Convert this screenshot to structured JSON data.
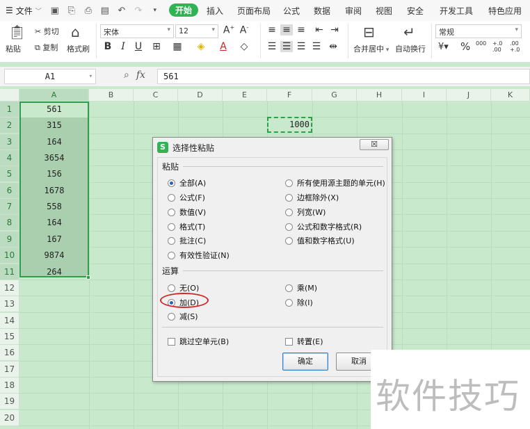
{
  "menubar": {
    "file_label": "文件",
    "tabs": [
      "开始",
      "插入",
      "页面布局",
      "公式",
      "数据",
      "审阅",
      "视图",
      "安全",
      "开发工具",
      "特色应用"
    ],
    "active_tab": "开始"
  },
  "ribbon": {
    "paste_label": "粘贴",
    "cut_label": "剪切",
    "copy_label": "复制",
    "format_painter_label": "格式刷",
    "font_name": "宋体",
    "font_size": "12",
    "bold": "B",
    "italic": "I",
    "underline": "U",
    "merge_center_label": "合并居中",
    "wrap_text_label": "自动换行",
    "number_format": "常规",
    "percent": "%",
    "thousands": "000",
    "inc_decimal": "+.0 .00",
    "dec_decimal": ".00 +.0"
  },
  "formula_bar": {
    "name_box": "A1",
    "fx_label": "fx",
    "value": "561"
  },
  "grid": {
    "columns": [
      "A",
      "B",
      "C",
      "D",
      "E",
      "F",
      "G",
      "H",
      "I",
      "J",
      "K"
    ],
    "rows": [
      "1",
      "2",
      "3",
      "4",
      "5",
      "6",
      "7",
      "8",
      "9",
      "10",
      "11",
      "12",
      "13",
      "14",
      "15",
      "16",
      "17",
      "18",
      "19",
      "20"
    ],
    "column_a_values": [
      "561",
      "315",
      "164",
      "3654",
      "156",
      "1678",
      "558",
      "164",
      "167",
      "9874",
      "264"
    ],
    "copied_cell_value": "1000",
    "selection_color": "#2f9e4b"
  },
  "dialog": {
    "title": "选择性粘贴",
    "close_label": "☒",
    "paste_group": "粘贴",
    "paste_options_left": [
      "全部(A)",
      "公式(F)",
      "数值(V)",
      "格式(T)",
      "批注(C)",
      "有效性验证(N)"
    ],
    "paste_options_right": [
      "所有使用源主题的单元(H)",
      "边框除外(X)",
      "列宽(W)",
      "公式和数字格式(R)",
      "值和数字格式(U)"
    ],
    "selected_paste": "全部(A)",
    "operation_group": "运算",
    "operation_options_left": [
      "无(O)",
      "加(D)",
      "减(S)"
    ],
    "operation_options_right": [
      "乘(M)",
      "除(I)"
    ],
    "selected_operation": "加(D)",
    "skip_blanks_label": "跳过空单元(B)",
    "transpose_label": "转置(E)",
    "ok_label": "确定",
    "cancel_label": "取消",
    "highlight_color": "#d12a2a"
  },
  "watermark": {
    "text": "软件技巧"
  }
}
